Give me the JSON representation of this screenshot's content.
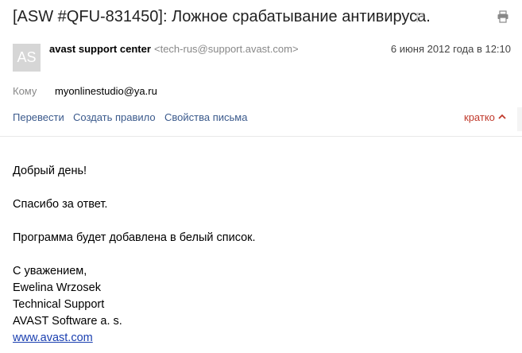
{
  "header": {
    "subject": "[ASW #QFU-831450]: Ложное срабатывание антивируса.",
    "flag_icon": "flag-icon",
    "print_icon": "printer-icon"
  },
  "sender": {
    "avatar_initials": "AS",
    "name": "avast support center",
    "email": "<tech-rus@support.avast.com>",
    "date": "6 июня 2012 года в 12:10"
  },
  "recipient": {
    "label": "Кому",
    "value": "myonlinestudio@ya.ru"
  },
  "actions": {
    "translate": "Перевести",
    "create_rule": "Создать правило",
    "properties": "Свойства письма",
    "brief": "кратко"
  },
  "message": {
    "greeting": "Добрый день!",
    "line1": "Спасибо за ответ.",
    "line2": "Программа будет добавлена в белый список.",
    "closing": "С уважением,",
    "name": "Ewelina Wrzosek",
    "role": "Technical Support",
    "company": "AVAST Software a. s.",
    "website": "www.avast.com"
  }
}
